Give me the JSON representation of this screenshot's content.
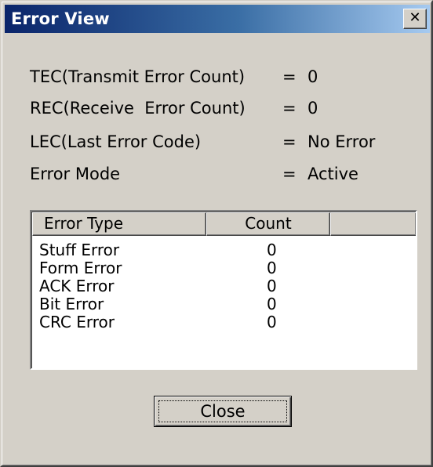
{
  "window": {
    "title": "Error View",
    "close_glyph": "✕"
  },
  "info": [
    {
      "label": "TEC(Transmit Error Count)",
      "eq": "=",
      "value": "0"
    },
    {
      "label": "REC(Receive  Error Count)",
      "eq": "=",
      "value": "0"
    },
    {
      "label": "LEC(Last Error Code)",
      "eq": "=",
      "value": "No Error"
    },
    {
      "label": "Error Mode",
      "eq": "=",
      "value": "Active"
    }
  ],
  "table": {
    "headers": [
      "Error Type",
      "Count",
      ""
    ],
    "rows": [
      {
        "type": "Stuff Error",
        "count": "0"
      },
      {
        "type": "Form Error",
        "count": "0"
      },
      {
        "type": "ACK Error",
        "count": "0"
      },
      {
        "type": "Bit Error",
        "count": "0"
      },
      {
        "type": "CRC Error",
        "count": "0"
      }
    ]
  },
  "buttons": {
    "close_label": "Close"
  },
  "colors": {
    "titlebar_start": "#0a246a",
    "titlebar_end": "#a6caf0",
    "face": "#d4d0c8"
  }
}
